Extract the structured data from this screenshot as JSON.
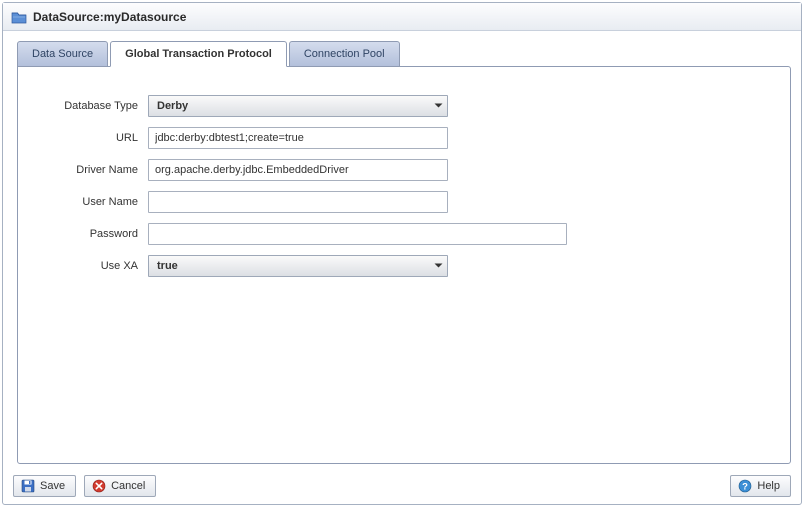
{
  "header": {
    "title": "DataSource:myDatasource"
  },
  "tabs": {
    "data_source": "Data Source",
    "global_tx": "Global Transaction Protocol",
    "connection_pool": "Connection Pool"
  },
  "form": {
    "database_type_label": "Database Type",
    "database_type_value": "Derby",
    "url_label": "URL",
    "url_value": "jdbc:derby:dbtest1;create=true",
    "driver_name_label": "Driver Name",
    "driver_name_value": "org.apache.derby.jdbc.EmbeddedDriver",
    "user_name_label": "User Name",
    "user_name_value": "",
    "password_label": "Password",
    "password_value": "",
    "use_xa_label": "Use XA",
    "use_xa_value": "true"
  },
  "buttons": {
    "save": "Save",
    "cancel": "Cancel",
    "help": "Help"
  }
}
